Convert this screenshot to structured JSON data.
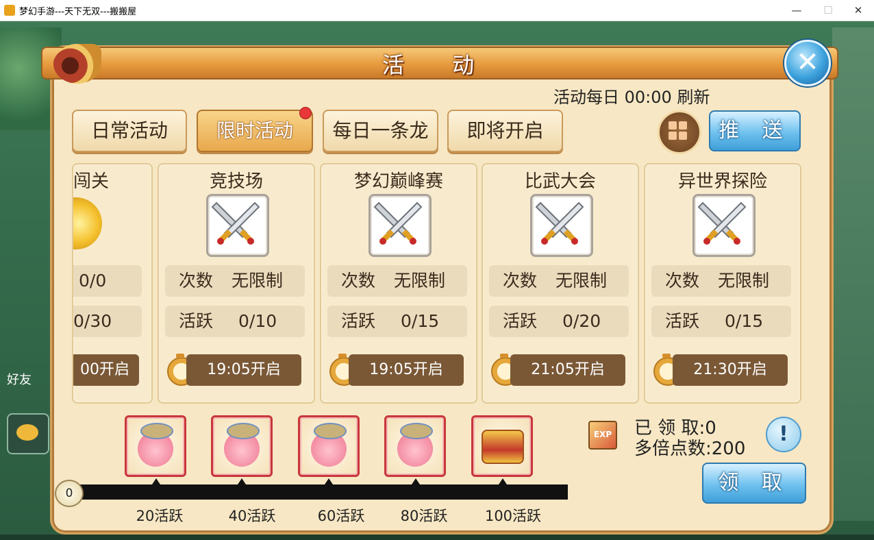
{
  "window": {
    "title": "梦幻手游---天下无双---搬搬屋",
    "minimize": "—",
    "maximize": "☐",
    "close": "✕"
  },
  "background": {
    "friend_label": "好友"
  },
  "dialog": {
    "title": "活 动",
    "refresh_note": "活动每日 00:00 刷新",
    "tabs": [
      {
        "label": "日常活动",
        "active": false
      },
      {
        "label": "限时活动",
        "active": true,
        "badge": "red-dot"
      },
      {
        "label": "每日一条龙",
        "active": false
      },
      {
        "label": "即将开启",
        "active": false
      }
    ],
    "push_button": "推 送",
    "close_icon": "✕",
    "cards": [
      {
        "name": "闯关",
        "count": "0/0",
        "active_pts": "0/30",
        "time": "00开启",
        "icon": "gold-coin-icon"
      },
      {
        "name": "竞技场",
        "count_label": "次数",
        "count": "无限制",
        "active_label": "活跃",
        "active_pts": "0/10",
        "time": "19:05开启",
        "icon": "crossed-swords-icon"
      },
      {
        "name": "梦幻巅峰赛",
        "count_label": "次数",
        "count": "无限制",
        "active_label": "活跃",
        "active_pts": "0/15",
        "time": "19:05开启",
        "icon": "crossed-swords-icon"
      },
      {
        "name": "比武大会",
        "count_label": "次数",
        "count": "无限制",
        "active_label": "活跃",
        "active_pts": "0/20",
        "time": "21:05开启",
        "icon": "crossed-swords-icon"
      },
      {
        "name": "异世界探险",
        "count_label": "次数",
        "count": "无限制",
        "active_label": "活跃",
        "active_pts": "0/15",
        "time": "21:30开启",
        "icon": "crossed-swords-icon"
      }
    ],
    "progress": {
      "current": "0",
      "milestones": [
        "20活跃",
        "40活跃",
        "60活跃",
        "80活跃",
        "100活跃"
      ],
      "rewards": [
        "pig-bag-icon",
        "pig-bag-icon",
        "pig-bag-icon",
        "pig-bag-icon",
        "treasure-chest-icon"
      ]
    },
    "claimed": "已 领 取:0",
    "multiplier": "多倍点数:200",
    "info_icon": "!",
    "exp_icon_text": "EXP",
    "claim_button": "领 取"
  }
}
